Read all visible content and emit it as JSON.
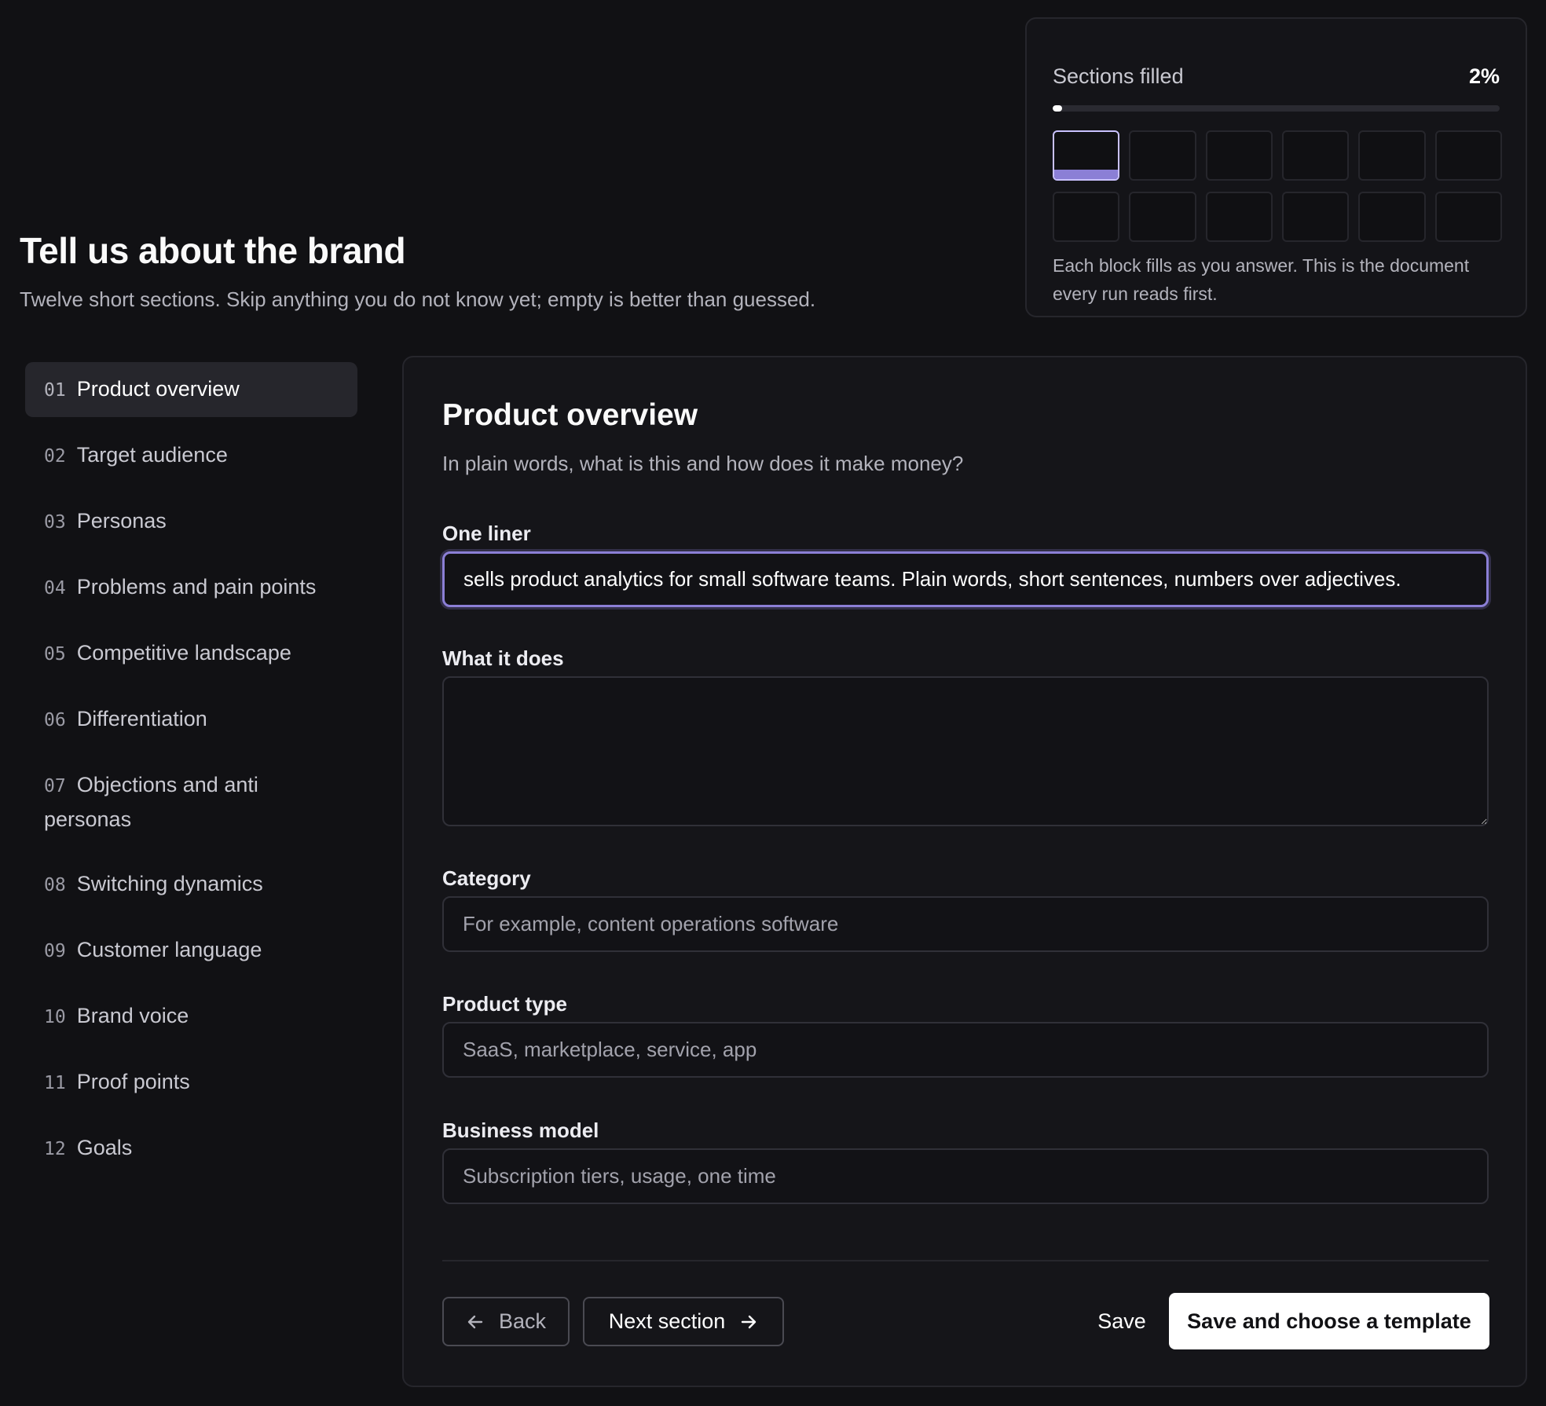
{
  "header": {
    "title": "Tell us about the brand",
    "subtitle": "Twelve short sections. Skip anything you do not know yet; empty is better than guessed."
  },
  "progress": {
    "label": "Sections filled",
    "percent_text": "2%",
    "percent_value": 2,
    "total_blocks": 12,
    "active_block": 1,
    "note": "Each block fills as you answer. This is the document every run reads first."
  },
  "nav": {
    "items": [
      {
        "num": "01",
        "label": "Product overview",
        "active": true
      },
      {
        "num": "02",
        "label": "Target audience"
      },
      {
        "num": "03",
        "label": "Personas"
      },
      {
        "num": "04",
        "label": "Problems and pain points"
      },
      {
        "num": "05",
        "label": "Competitive landscape"
      },
      {
        "num": "06",
        "label": "Differentiation"
      },
      {
        "num": "07",
        "label": "Objections and anti personas"
      },
      {
        "num": "08",
        "label": "Switching dynamics"
      },
      {
        "num": "09",
        "label": "Customer language"
      },
      {
        "num": "10",
        "label": "Brand voice"
      },
      {
        "num": "11",
        "label": "Proof points"
      },
      {
        "num": "12",
        "label": "Goals"
      }
    ]
  },
  "form": {
    "title": "Product overview",
    "description": "In plain words, what is this and how does it make money?",
    "one_liner": {
      "label": "One liner",
      "value": "sells product analytics for small software teams. Plain words, short sentences, numbers over adjectives."
    },
    "what_it_does": {
      "label": "What it does",
      "value": ""
    },
    "category": {
      "label": "Category",
      "placeholder": "For example, content operations software"
    },
    "product_type": {
      "label": "Product type",
      "placeholder": "SaaS, marketplace, service, app"
    },
    "business_model": {
      "label": "Business model",
      "placeholder": "Subscription tiers, usage, one time"
    }
  },
  "actions": {
    "back": "Back",
    "next": "Next section",
    "save": "Save",
    "primary": "Save and choose a template"
  },
  "colors": {
    "background": "#111114",
    "accent": "#8b7fd6",
    "focus_border": "#8b7fd6"
  }
}
